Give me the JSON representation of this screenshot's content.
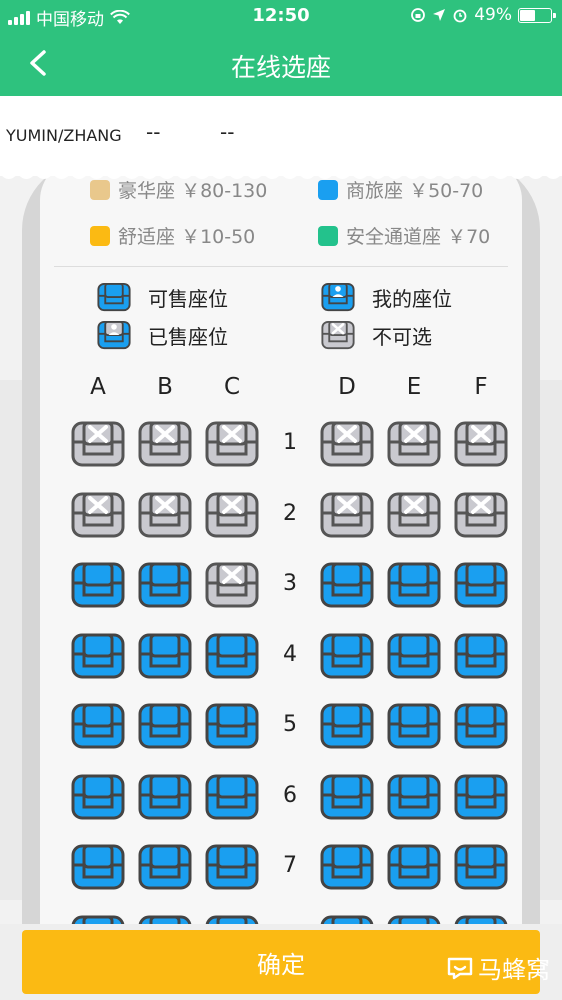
{
  "status_bar": {
    "carrier": "中国移动",
    "time": "12:50",
    "battery": "49%"
  },
  "nav": {
    "title": "在线选座"
  },
  "passenger": {
    "name": "YUMIN/ZHANG",
    "field1": "--",
    "field2": "--"
  },
  "price_legend": [
    {
      "label": "豪华座",
      "price": "￥80-130",
      "color": "#e9c88c"
    },
    {
      "label": "商旅座",
      "price": "￥50-70",
      "color": "#1a9ff0"
    },
    {
      "label": "舒适座",
      "price": "￥10-50",
      "color": "#fbba13"
    },
    {
      "label": "安全通道座",
      "price": "￥70",
      "color": "#23c28c"
    }
  ],
  "status_legend": {
    "available": "可售座位",
    "mine": "我的座位",
    "sold": "已售座位",
    "unavailable": "不可选"
  },
  "columns": [
    "A",
    "B",
    "C",
    "D",
    "E",
    "F"
  ],
  "rows": [
    {
      "number": "1",
      "seats": [
        "unavailable",
        "unavailable",
        "unavailable",
        "unavailable",
        "unavailable",
        "unavailable"
      ]
    },
    {
      "number": "2",
      "seats": [
        "unavailable",
        "unavailable",
        "unavailable",
        "unavailable",
        "unavailable",
        "unavailable"
      ]
    },
    {
      "number": "3",
      "seats": [
        "available",
        "available",
        "unavailable",
        "available",
        "available",
        "available"
      ]
    },
    {
      "number": "4",
      "seats": [
        "available",
        "available",
        "available",
        "available",
        "available",
        "available"
      ]
    },
    {
      "number": "5",
      "seats": [
        "available",
        "available",
        "available",
        "available",
        "available",
        "available"
      ]
    },
    {
      "number": "6",
      "seats": [
        "available",
        "available",
        "available",
        "available",
        "available",
        "available"
      ]
    },
    {
      "number": "7",
      "seats": [
        "available",
        "available",
        "available",
        "available",
        "available",
        "available"
      ]
    },
    {
      "number": "",
      "seats": [
        "available",
        "available",
        "available",
        "available",
        "available",
        "available"
      ]
    }
  ],
  "colors": {
    "brand": "#2ec27e",
    "seat_available": "#1a9ff0",
    "seat_unavailable": "#c9c9cf",
    "confirm": "#fbba13"
  },
  "footer": {
    "confirm_label": "确定",
    "watermark": "马蜂窝"
  }
}
